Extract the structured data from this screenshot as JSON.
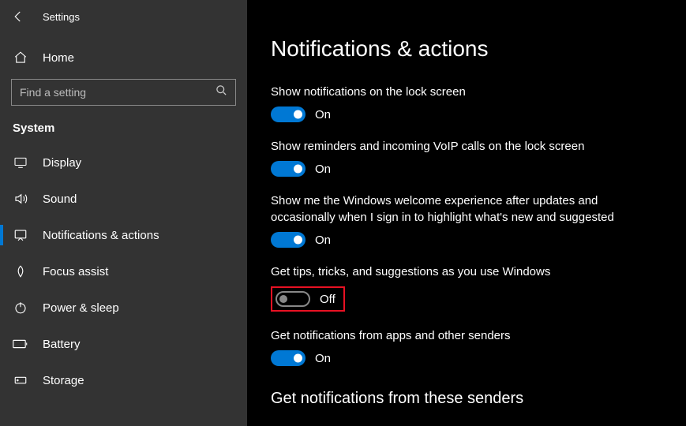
{
  "app_title": "Settings",
  "home_label": "Home",
  "search_placeholder": "Find a setting",
  "section_label": "System",
  "nav": {
    "display": "Display",
    "sound": "Sound",
    "notifications": "Notifications & actions",
    "focus": "Focus assist",
    "power": "Power & sleep",
    "battery": "Battery",
    "storage": "Storage"
  },
  "page_title": "Notifications & actions",
  "settings": {
    "lock_notif": {
      "text": "Show notifications on the lock screen",
      "state": "On"
    },
    "voip": {
      "text": "Show reminders and incoming VoIP calls on the lock screen",
      "state": "On"
    },
    "welcome": {
      "text": "Show me the Windows welcome experience after updates and occasionally when I sign in to highlight what's new and suggested",
      "state": "On"
    },
    "tips": {
      "text": "Get tips, tricks, and suggestions as you use Windows",
      "state": "Off"
    },
    "apps": {
      "text": "Get notifications from apps and other senders",
      "state": "On"
    }
  },
  "senders_heading": "Get notifications from these senders"
}
